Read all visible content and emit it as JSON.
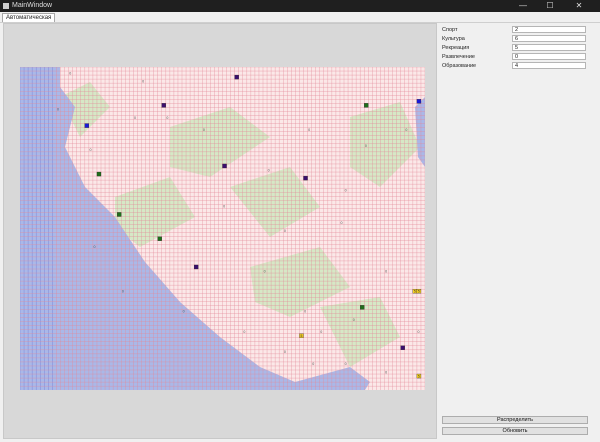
{
  "window": {
    "title": "MainWindow",
    "minimize_glyph": "—",
    "maximize_glyph": "☐",
    "close_glyph": "✕"
  },
  "tabs": [
    {
      "label": "Автоматическая"
    }
  ],
  "params": [
    {
      "label": "Спорт",
      "value": "2"
    },
    {
      "label": "Культура",
      "value": "6"
    },
    {
      "label": "Рекреация",
      "value": "5"
    },
    {
      "label": "Развлечение",
      "value": "0"
    },
    {
      "label": "Образование",
      "value": "4"
    }
  ],
  "buttons": {
    "distribute": "Распределить",
    "refresh": "Обновить"
  },
  "map": {
    "colors": {
      "cell_fill": "#fbe8e8",
      "grid": "#e48a9a",
      "water": "#aab8e8",
      "water_grid": "#6a76d8",
      "park": "#cfe8c0",
      "purple": "#3c0f6e",
      "blue": "#1a1ad8",
      "green": "#1f6e1a",
      "yellow": "#f5d020"
    },
    "cell_glyph": "0",
    "markers": [
      {
        "kind": "purple",
        "col": 53,
        "row": 2
      },
      {
        "kind": "purple",
        "col": 35,
        "row": 9
      },
      {
        "kind": "blue",
        "col": 16,
        "row": 14
      },
      {
        "kind": "blue",
        "col": 98,
        "row": 8
      },
      {
        "kind": "green",
        "col": 85,
        "row": 9
      },
      {
        "kind": "green",
        "col": 19,
        "row": 26
      },
      {
        "kind": "purple",
        "col": 50,
        "row": 24
      },
      {
        "kind": "purple",
        "col": 70,
        "row": 27
      },
      {
        "kind": "green",
        "col": 24,
        "row": 36
      },
      {
        "kind": "green",
        "col": 34,
        "row": 42
      },
      {
        "kind": "purple",
        "col": 43,
        "row": 49
      },
      {
        "kind": "yellow",
        "col": 97,
        "row": 55,
        "label": "5"
      },
      {
        "kind": "yellow",
        "col": 98,
        "row": 55,
        "label": "5"
      },
      {
        "kind": "green",
        "col": 84,
        "row": 59
      },
      {
        "kind": "yellow",
        "col": 69,
        "row": 66,
        "label": "5"
      },
      {
        "kind": "purple",
        "col": 94,
        "row": 69
      },
      {
        "kind": "yellow",
        "col": 98,
        "row": 76,
        "label": "5"
      }
    ]
  }
}
